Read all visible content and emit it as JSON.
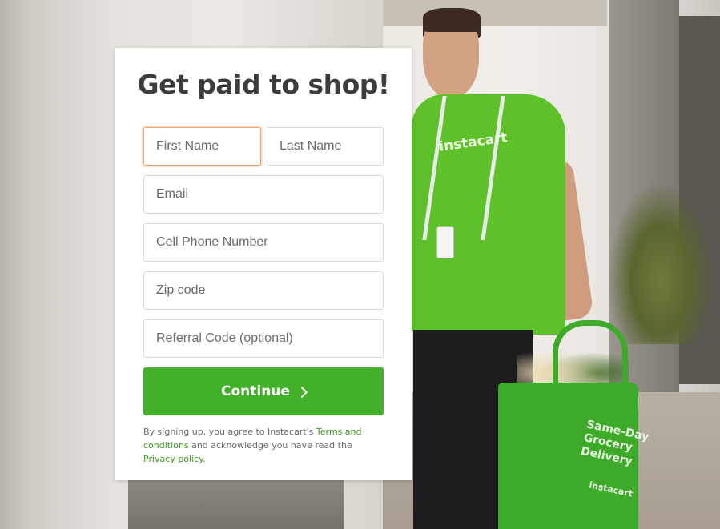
{
  "form": {
    "title": "Get paid to shop!",
    "first_name_placeholder": "First Name",
    "last_name_placeholder": "Last Name",
    "email_placeholder": "Email",
    "phone_placeholder": "Cell Phone Number",
    "zip_placeholder": "Zip code",
    "referral_placeholder": "Referral Code (optional)",
    "continue_label": "Continue"
  },
  "legal": {
    "prefix": "By signing up, you agree to Instacart's ",
    "terms_link": "Terms and conditions",
    "middle": " and acknowledge you have read the ",
    "privacy_link": "Privacy policy",
    "suffix": "."
  },
  "background": {
    "shirt_logo": "instacart",
    "bag_text": "Same-Day\nGrocery\nDelivery",
    "bag_brand": "instacart"
  },
  "colors": {
    "brand_green": "#43b02a",
    "link_green": "#3c9a1e",
    "focus_orange": "#f2a36a",
    "title_text": "#3c3c3c"
  },
  "icons": {
    "continue_chevron": "chevron-right-icon"
  }
}
